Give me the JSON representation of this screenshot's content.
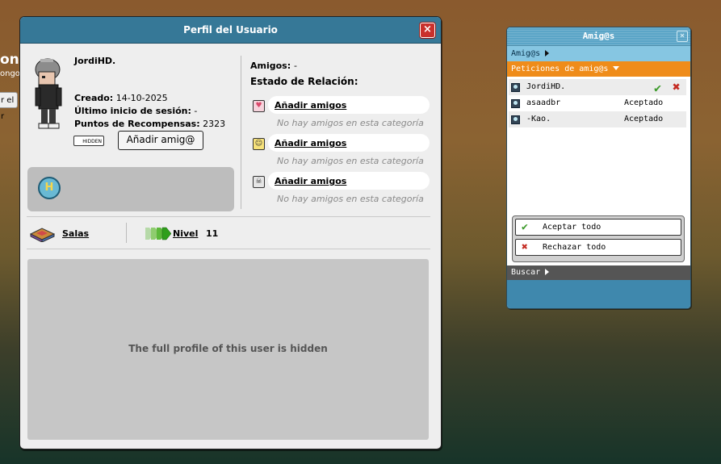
{
  "background": {
    "text_large": "ong",
    "text_small": "ongo",
    "button_label": "r el r"
  },
  "profile": {
    "title": "Perfil del Usuario",
    "close_icon": "×",
    "username": "JordiHD.",
    "created_label": "Creado:",
    "created_value": "14-10-2025",
    "last_login_label": "Último inicio de sesión:",
    "last_login_value": "-",
    "rewards_label": "Puntos de Recompensas:",
    "rewards_value": "2323",
    "hidden_badge": "HIDDEN",
    "add_friend_button": "Añadir amig@",
    "badge_letter": "H",
    "friends_label": "Amigos:",
    "friends_value": "-",
    "relationship_title": "Estado de Relación:",
    "relationships": [
      {
        "icon": "heart-icon",
        "glyph": "♥",
        "color": "#d9486a",
        "link": "Añadir amigos",
        "empty": "No hay amigos en esta categoría"
      },
      {
        "icon": "smile-icon",
        "glyph": "☺",
        "color": "#d9b600",
        "link": "Añadir amigos",
        "empty": "No hay amigos en esta categoría"
      },
      {
        "icon": "skull-icon",
        "glyph": "☠",
        "color": "#555555",
        "link": "Añadir amigos",
        "empty": "No hay amigos en esta categoría"
      }
    ],
    "rooms_link": "Salas",
    "level_link": "Nivel",
    "level_value": "11",
    "hidden_message": "The full profile of this user is hidden"
  },
  "friends": {
    "title": "Amig@s",
    "close_icon": "×",
    "tab_friends": "Amig@s",
    "tab_requests": "Peticiones de amig@s",
    "requests": [
      {
        "name": "JordiHD.",
        "status": "",
        "pending": true
      },
      {
        "name": "asaadbr",
        "status": "Aceptado",
        "pending": false
      },
      {
        "name": "-Kao.",
        "status": "Aceptado",
        "pending": false
      }
    ],
    "accept_all": "Aceptar todo",
    "reject_all": "Rechazar todo",
    "search": "Buscar"
  },
  "colors": {
    "header_blue": "#367897",
    "requests_orange": "#ef8c1a",
    "accept_green": "#3c9a2a",
    "reject_red": "#c42b22"
  }
}
